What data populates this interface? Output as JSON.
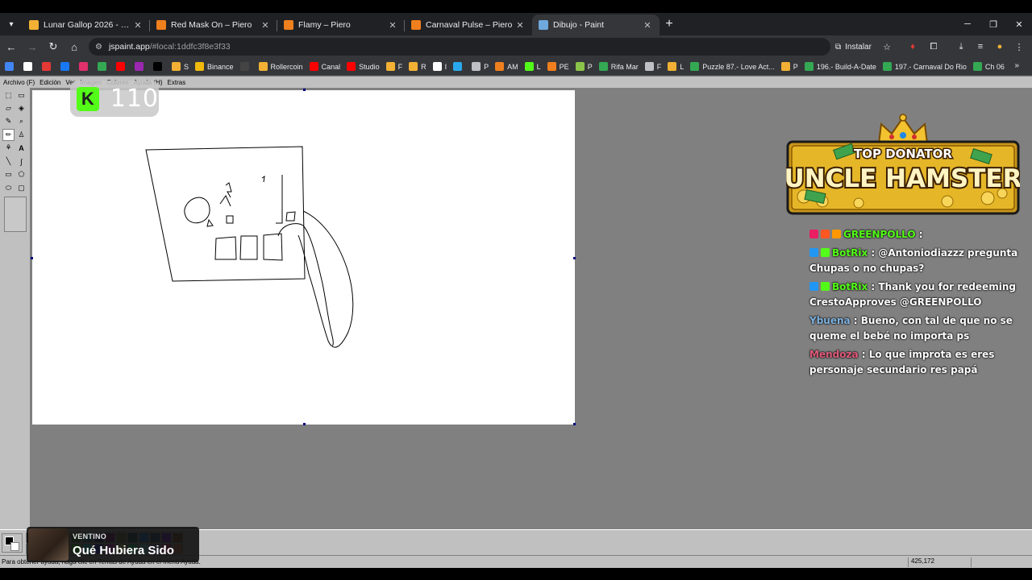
{
  "browser": {
    "tabs": [
      {
        "title": "Lunar Gallop 2026 - RollerCoin",
        "color": "#f2b134"
      },
      {
        "title": "Red Mask On – Piero",
        "color": "#f07f1d"
      },
      {
        "title": "Flamy – Piero",
        "color": "#f07f1d"
      },
      {
        "title": "Carnaval Pulse – Piero",
        "color": "#f07f1d"
      },
      {
        "title": "Dibujo - Paint",
        "color": "#6fa8dc"
      }
    ],
    "active_tab": 4,
    "url_host": "jspaint.app",
    "url_path": "/#local:1ddfc3f8e3f33",
    "install_label": "Instalar",
    "bookmarks": [
      {
        "label": "",
        "color": "#4285f4"
      },
      {
        "label": "",
        "color": "#ffffff"
      },
      {
        "label": "",
        "color": "#e53935"
      },
      {
        "label": "",
        "color": "#1877f2"
      },
      {
        "label": "",
        "color": "#e1306c"
      },
      {
        "label": "",
        "color": "#34a853"
      },
      {
        "label": "",
        "color": "#ff0000"
      },
      {
        "label": "",
        "color": "#9c27b0"
      },
      {
        "label": "",
        "color": "#000000"
      },
      {
        "label": "S",
        "color": "#f2b134"
      },
      {
        "label": "Binance",
        "color": "#f0b90b"
      },
      {
        "label": "",
        "color": "#444444"
      },
      {
        "label": "Rollercoin",
        "color": "#f2b134"
      },
      {
        "label": "Canal",
        "color": "#ff0000"
      },
      {
        "label": "Studio",
        "color": "#ff0000"
      },
      {
        "label": "F",
        "color": "#f2b134"
      },
      {
        "label": "R",
        "color": "#f2b134"
      },
      {
        "label": "I",
        "color": "#ffffff"
      },
      {
        "label": "",
        "color": "#29a9eb"
      },
      {
        "label": "P",
        "color": "#bdc1c6"
      },
      {
        "label": "AM",
        "color": "#f07f1d"
      },
      {
        "label": "L",
        "color": "#53fc18"
      },
      {
        "label": "PE",
        "color": "#f07f1d"
      },
      {
        "label": "P",
        "color": "#8bc34a"
      },
      {
        "label": "Rifa Mar",
        "color": "#34a853"
      },
      {
        "label": "F",
        "color": "#bdc1c6"
      },
      {
        "label": "L",
        "color": "#f2b134"
      },
      {
        "label": "Puzzle 87.- Love Act...",
        "color": "#34a853"
      },
      {
        "label": "P",
        "color": "#f2b134"
      },
      {
        "label": "196.- Build-A-Date",
        "color": "#34a853"
      },
      {
        "label": "197.- Carnaval Do Rio",
        "color": "#34a853"
      },
      {
        "label": "Ch 06",
        "color": "#34a853"
      }
    ]
  },
  "paint": {
    "menu": [
      "Archivo (F)",
      "Edición",
      "Ver",
      "Imagen",
      "Colores",
      "Ayuda (H)",
      "Extras"
    ],
    "status_text": "Para obtener ayuda, haga clic en Temas de Ayuda en el menú Ayuda.",
    "status_coords": "425,172",
    "palette": [
      "#000000",
      "#808080",
      "#800000",
      "#808000",
      "#008000",
      "#008080",
      "#000080",
      "#800080",
      "#808040",
      "#004040",
      "#0080ff",
      "#004080",
      "#8000ff",
      "#804000",
      "#ffffff",
      "#c0c0c0",
      "#ff0000",
      "#ffff00",
      "#00ff00",
      "#00ffff",
      "#0000ff",
      "#ff00ff",
      "#ffff80",
      "#00ff80",
      "#80ffff",
      "#8080ff",
      "#ff0080",
      "#ff8040"
    ]
  },
  "overlay": {
    "kick_count": "110",
    "donator": {
      "line1": "TOP DONATOR",
      "line2": "UNCLE HAMSTER"
    },
    "chat": [
      {
        "user": "GREENPOLLO",
        "text": ":",
        "user_color": "#53fc18",
        "badges": [
          "#e91e63",
          "#ff5722",
          "#ff9800"
        ]
      },
      {
        "user": "BotRix",
        "text": ": @Antoniodiazzz pregunta Chupas o no chupas?",
        "user_color": "#53fc18",
        "badges": [
          "#2196f3",
          "#53fc18"
        ]
      },
      {
        "user": "BotRix",
        "text": ": Thank you for redeeming CrestoApproves @GREENPOLLO",
        "user_color": "#53fc18",
        "badges": [
          "#2196f3",
          "#53fc18"
        ]
      },
      {
        "user": "Ybuena",
        "text": ": Bueno, con tal de que no se queme el bebé no importa ps",
        "user_color": "#7fb3e0",
        "badges": []
      },
      {
        "user": "Mendoza",
        "text": ": Lo que improta es eres personaje secundario res papá",
        "user_color": "#e05a7a",
        "badges": []
      }
    ],
    "now_playing": {
      "artist": "VENTINO",
      "title": "Qué Hubiera Sido"
    }
  }
}
